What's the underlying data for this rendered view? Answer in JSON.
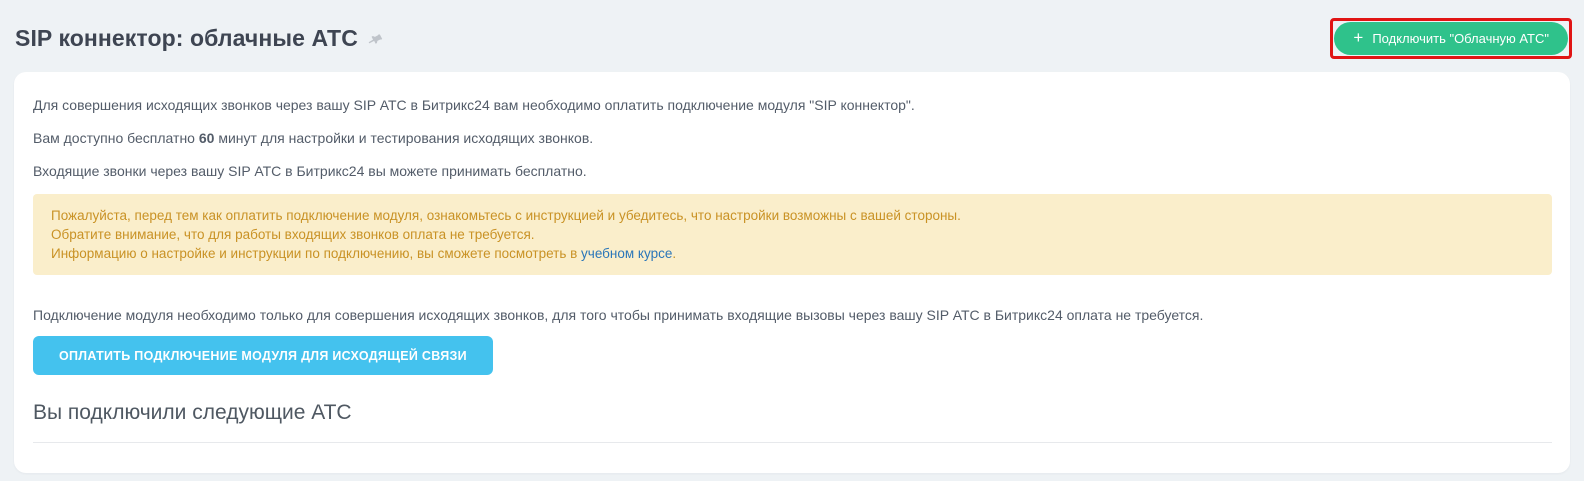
{
  "page": {
    "title": "SIP коннектор: облачные АТС"
  },
  "header": {
    "plus_glyph": "+",
    "connect_button_label": "Подключить \"Облачную АТС\""
  },
  "intro": {
    "p1": "Для совершения исходящих звонков через вашу SIP АТС в Битрикс24 вам необходимо оплатить подключение модуля \"SIP коннектор\".",
    "p2_before": "Вам доступно бесплатно ",
    "p2_bold": "60",
    "p2_after": " минут для настройки и тестирования исходящих звонков.",
    "p3": "Входящие звонки через вашу SIP АТС в Битрикс24 вы можете принимать бесплатно."
  },
  "warning": {
    "line1": "Пожалуйста, перед тем как оплатить подключение модуля, ознакомьтесь с инструкцией и убедитесь, что настройки возможны с вашей стороны.",
    "line2": "Обратите внимание, что для работы входящих звонков оплата не требуется.",
    "line3_before": "Информацию о настройке и инструкции по подключению, вы сможете посмотреть в ",
    "line3_link": "учебном курсе",
    "line3_after": "."
  },
  "main": {
    "note": "Подключение модуля необходимо только для совершения исходящих звонков, для того чтобы принимать входящие вызовы через вашу SIP АТС в Битрикс24 оплата не требуется.",
    "pay_button_label": "ОПЛАТИТЬ ПОДКЛЮЧЕНИЕ МОДУЛЯ ДЛЯ ИСХОДЯЩЕЙ СВЯЗИ",
    "connected_heading": "Вы подключили следующие АТС"
  },
  "colors": {
    "page_background": "#eef2f5",
    "green_button": "#2fc28b",
    "blue_button": "#44c2ee",
    "warning_background": "#faeecb",
    "warning_text": "#c99225",
    "link": "#2a76b9",
    "highlight_border": "#e01414"
  }
}
